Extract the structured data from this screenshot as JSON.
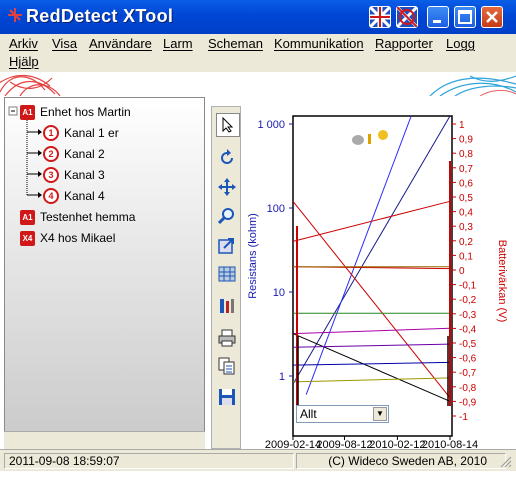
{
  "window": {
    "title": "RedDetect XTool"
  },
  "menu": {
    "items": [
      "Arkiv",
      "Visa",
      "Användare",
      "Larm",
      "Scheman",
      "Kommunikation",
      "Rapporter",
      "Logg",
      "Hjälp"
    ]
  },
  "tree": {
    "nodes": [
      {
        "label": "Enhet hos Martin",
        "icon": "unit-icon",
        "badge": "A1"
      },
      {
        "label": "Kanal 1 er",
        "icon": "channel-icon",
        "badge": "1"
      },
      {
        "label": "Kanal 2",
        "icon": "channel-icon",
        "badge": "2"
      },
      {
        "label": "Kanal 3",
        "icon": "channel-icon",
        "badge": "3"
      },
      {
        "label": "Kanal 4",
        "icon": "channel-icon",
        "badge": "4"
      },
      {
        "label": "Testenhet hemma",
        "icon": "unit-icon",
        "badge": "A1"
      },
      {
        "label": "X4 hos Mikael",
        "icon": "unit-icon",
        "badge": "X4"
      }
    ]
  },
  "toolbar": {
    "tools": [
      "pointer-icon",
      "rotate-icon",
      "move-icon",
      "zoom-icon",
      "export-icon",
      "table-icon",
      "settings-icon",
      "print-icon",
      "copy-icon",
      "save-icon"
    ]
  },
  "chart_data": {
    "type": "line",
    "ylabel_left": "Resistans (kohm)",
    "ylabel_right": "Batterivärkan (V)",
    "y_left_scale": "log",
    "y_left_ticks": [
      "1 000",
      "100",
      "10",
      "1"
    ],
    "y_right_ticks": [
      "1",
      "0,9",
      "0,8",
      "0,7",
      "0,6",
      "0,5",
      "0,4",
      "0,3",
      "0,2",
      "0,1",
      "0",
      "-0,1",
      "-0,2",
      "-0,3",
      "-0,4",
      "-0,5",
      "-0,6",
      "-0,7",
      "-0,8",
      "-0,9",
      "-1"
    ],
    "x_ticks": [
      "2009-02-14",
      "2009-08-12",
      "2010-02-12",
      "2010-08-14"
    ],
    "series": [
      {
        "color": "#1a1a8c",
        "x": [
          "2009-02-14",
          "2010-08-14"
        ],
        "y": [
          0.8,
          3000
        ]
      },
      {
        "color": "#2a2aff",
        "x": [
          "2009-04-01",
          "2010-04-01"
        ],
        "y": [
          0.6,
          1400
        ]
      },
      {
        "color": "#cc0000",
        "x": [
          "2009-02-14",
          "2010-08-14"
        ],
        "y": [
          40,
          120
        ]
      },
      {
        "color": "#cc0000",
        "x": [
          "2009-02-14",
          "2010-08-14"
        ],
        "y": [
          120,
          0.55
        ]
      },
      {
        "color": "#cc0000",
        "x": [
          "2009-02-14",
          "2010-08-14"
        ],
        "y": [
          20,
          19
        ]
      },
      {
        "color": "#996600",
        "x": [
          "2009-02-14",
          "2010-08-14"
        ],
        "y": [
          20,
          20
        ]
      },
      {
        "color": "#228822",
        "x": [
          "2009-02-14",
          "2010-08-14"
        ],
        "y": [
          5.6,
          5.6
        ]
      },
      {
        "color": "#aa00aa",
        "x": [
          "2009-02-14",
          "2010-08-14"
        ],
        "y": [
          3.2,
          3.7
        ]
      },
      {
        "color": "#000000",
        "x": [
          "2009-02-14",
          "2010-08-14"
        ],
        "y": [
          3.2,
          0.5
        ]
      },
      {
        "color": "#6600aa",
        "x": [
          "2009-02-14",
          "2010-08-14"
        ],
        "y": [
          2.2,
          2.4
        ]
      },
      {
        "color": "#0000aa",
        "x": [
          "2009-02-14",
          "2010-08-14"
        ],
        "y": [
          1.35,
          1.45
        ]
      },
      {
        "color": "#999900",
        "x": [
          "2009-02-14",
          "2010-08-14"
        ],
        "y": [
          0.85,
          0.95
        ]
      }
    ],
    "weather_icon": "partly-cloudy-icon"
  },
  "chart_select": {
    "value": "Allt"
  },
  "status": {
    "datetime": "2011-09-08 18:59:07",
    "copyright": "(C) Wideco Sweden AB, 2010"
  }
}
